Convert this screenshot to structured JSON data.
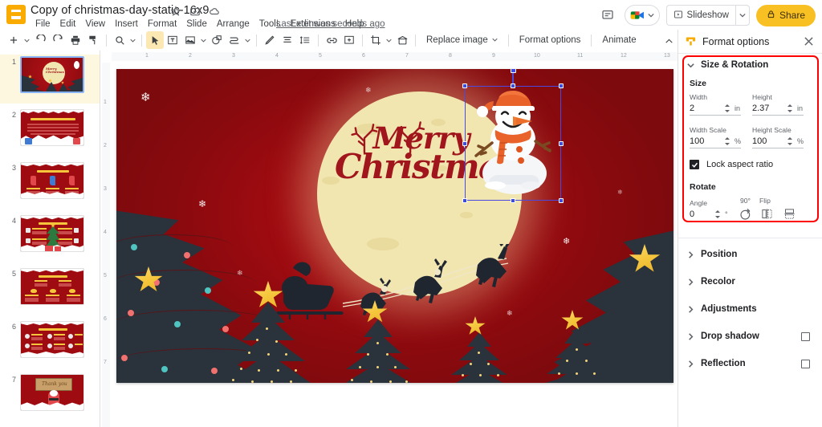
{
  "app": {
    "logo_icon": "slides-logo-icon",
    "doc_title": "Copy of christmas-day-static-16x9",
    "title_icons": [
      "star-icon",
      "move-to-folder-icon",
      "cloud-status-icon"
    ],
    "menus": [
      "File",
      "Edit",
      "View",
      "Insert",
      "Format",
      "Slide",
      "Arrange",
      "Tools",
      "Extensions",
      "Help"
    ],
    "last_edit": "Last edit was seconds ago"
  },
  "topright": {
    "comment_icon": "comment-icon",
    "meet_icon": "meet-camera-icon",
    "meet_caret_icon": "chevron-down-icon",
    "slideshow_label": "Slideshow",
    "slideshow_icon": "present-icon",
    "slideshow_caret_icon": "chevron-down-icon",
    "share_label": "Share",
    "share_icon": "lock-icon",
    "share_color": "#f9c024"
  },
  "toolbar": {
    "items": [
      {
        "name": "new-slide-button",
        "icon": "plus-icon",
        "type": "icon"
      },
      {
        "name": "new-slide-caret",
        "icon": "chevron-down-icon",
        "type": "caret"
      },
      {
        "name": "undo-button",
        "icon": "undo-icon",
        "type": "icon"
      },
      {
        "name": "redo-button",
        "icon": "redo-icon",
        "type": "icon"
      },
      {
        "name": "print-button",
        "icon": "print-icon",
        "type": "icon"
      },
      {
        "name": "paint-format-button",
        "icon": "paint-format-icon",
        "type": "icon"
      },
      {
        "name": "separator-1",
        "type": "sep"
      },
      {
        "name": "zoom-button",
        "icon": "magnifier-icon",
        "type": "icon"
      },
      {
        "name": "zoom-caret",
        "icon": "chevron-down-icon",
        "type": "caret"
      },
      {
        "name": "separator-2",
        "type": "sep"
      },
      {
        "name": "select-tool-button",
        "icon": "cursor-arrow-icon",
        "type": "icon",
        "active": true
      },
      {
        "name": "text-box-button",
        "icon": "text-box-icon",
        "type": "icon"
      },
      {
        "name": "insert-image-button",
        "icon": "image-icon",
        "type": "icon"
      },
      {
        "name": "insert-image-caret",
        "icon": "chevron-down-icon",
        "type": "caret"
      },
      {
        "name": "shape-button",
        "icon": "shape-icon",
        "type": "icon"
      },
      {
        "name": "line-button",
        "icon": "line-icon",
        "type": "icon"
      },
      {
        "name": "line-caret",
        "icon": "chevron-down-icon",
        "type": "caret"
      },
      {
        "name": "separator-3",
        "type": "sep"
      },
      {
        "name": "pen-button",
        "icon": "pen-icon",
        "type": "icon"
      },
      {
        "name": "align-button",
        "icon": "align-icon",
        "type": "icon"
      },
      {
        "name": "line-spacing-button",
        "icon": "line-spacing-icon",
        "type": "icon"
      },
      {
        "name": "separator-4",
        "type": "sep"
      },
      {
        "name": "insert-link-button",
        "icon": "link-icon",
        "type": "icon"
      },
      {
        "name": "add-comment-button",
        "icon": "add-comment-icon",
        "type": "icon"
      },
      {
        "name": "separator-5",
        "type": "sep"
      },
      {
        "name": "crop-button",
        "icon": "crop-icon",
        "type": "icon"
      },
      {
        "name": "crop-caret",
        "icon": "chevron-down-icon",
        "type": "caret"
      },
      {
        "name": "mask-button",
        "icon": "mask-shape-icon",
        "type": "icon"
      },
      {
        "name": "separator-6",
        "type": "sep"
      }
    ],
    "replace_image_label": "Replace image",
    "replace_image_caret": "chevron-down-icon",
    "format_options_label": "Format options",
    "animate_label": "Animate",
    "collapse_icon": "chevron-up-icon"
  },
  "filmstrip": {
    "selected": 1,
    "slides": [
      {
        "number": "1",
        "thumb": "title-merry-christmas"
      },
      {
        "number": "2",
        "thumb": "why-we-celebrate"
      },
      {
        "number": "3",
        "thumb": "three-step-infographic-stockings"
      },
      {
        "number": "4",
        "thumb": "four-step-infographic-tree"
      },
      {
        "number": "5",
        "thumb": "five-step-infographic-bells"
      },
      {
        "number": "6",
        "thumb": "six-step-infographic-icons"
      },
      {
        "number": "7",
        "thumb": "thank-you-santa"
      }
    ]
  },
  "ruler": {
    "horizontal_ticks": [
      "1",
      "2",
      "3",
      "4",
      "5",
      "6",
      "7",
      "8",
      "9",
      "10",
      "11",
      "12",
      "13"
    ],
    "vertical_ticks": [
      "1",
      "2",
      "3",
      "4",
      "5",
      "6",
      "7"
    ]
  },
  "slide": {
    "background_color": "#9e0b10",
    "moon_color": "#f2e6b0",
    "tree_color": "#2a323c",
    "star_color": "#f5c63c",
    "heading_line1": "Merry",
    "heading_line2": "Christmas",
    "heading_color": "#a0161c",
    "selected_object": "snowman-image"
  },
  "panel": {
    "icon": "format-options-icon",
    "title": "Format options",
    "close_icon": "close-icon",
    "size_rotation": {
      "label": "Size & Rotation",
      "chevron": "chevron-down-icon",
      "expanded": true,
      "size_label": "Size",
      "width_label": "Width",
      "width_value": "2",
      "width_unit": "in",
      "height_label": "Height",
      "height_value": "2.37",
      "height_unit": "in",
      "width_scale_label": "Width Scale",
      "width_scale_value": "100",
      "width_scale_unit": "%",
      "height_scale_label": "Height Scale",
      "height_scale_value": "100",
      "height_scale_unit": "%",
      "lock_aspect_label": "Lock aspect ratio",
      "lock_aspect_checked": true,
      "rotate_label": "Rotate",
      "angle_label": "Angle",
      "angle_value": "0",
      "angle_unit": "°",
      "rotate90_label": "90°",
      "rotate90_icon": "rotate-90-icon",
      "flip_label": "Flip",
      "flip_horizontal_icon": "flip-horizontal-icon",
      "flip_vertical_icon": "flip-vertical-icon"
    },
    "sections": [
      {
        "name": "position",
        "label": "Position",
        "chevron": "chevron-right-icon",
        "checkbox": false
      },
      {
        "name": "recolor",
        "label": "Recolor",
        "chevron": "chevron-right-icon",
        "checkbox": false
      },
      {
        "name": "adjustments",
        "label": "Adjustments",
        "chevron": "chevron-right-icon",
        "checkbox": false
      },
      {
        "name": "drop-shadow",
        "label": "Drop shadow",
        "chevron": "chevron-right-icon",
        "checkbox": true
      },
      {
        "name": "reflection",
        "label": "Reflection",
        "chevron": "chevron-right-icon",
        "checkbox": true
      }
    ],
    "highlight_color": "#ff0000"
  }
}
